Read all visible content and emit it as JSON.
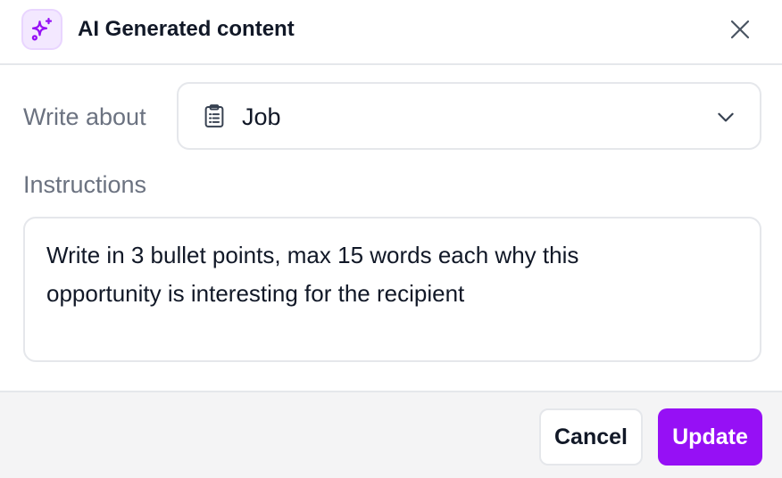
{
  "header": {
    "title": "AI Generated content",
    "icon": "sparkles-icon",
    "close_icon": "close-icon"
  },
  "write_about": {
    "label": "Write about",
    "selected_value": "Job",
    "value_icon": "clipboard-list-icon",
    "dropdown_icon": "chevron-down-icon"
  },
  "instructions": {
    "label": "Instructions",
    "value": "Write in 3 bullet points, max 15 words each why this opportunity is interesting for the recipient"
  },
  "footer": {
    "cancel_label": "Cancel",
    "update_label": "Update"
  },
  "colors": {
    "accent": "#9610f5",
    "icon_bg": "#f3e8ff",
    "border": "#e5e7eb",
    "footer_bg": "#f4f4f5",
    "muted_text": "#6b7280"
  }
}
